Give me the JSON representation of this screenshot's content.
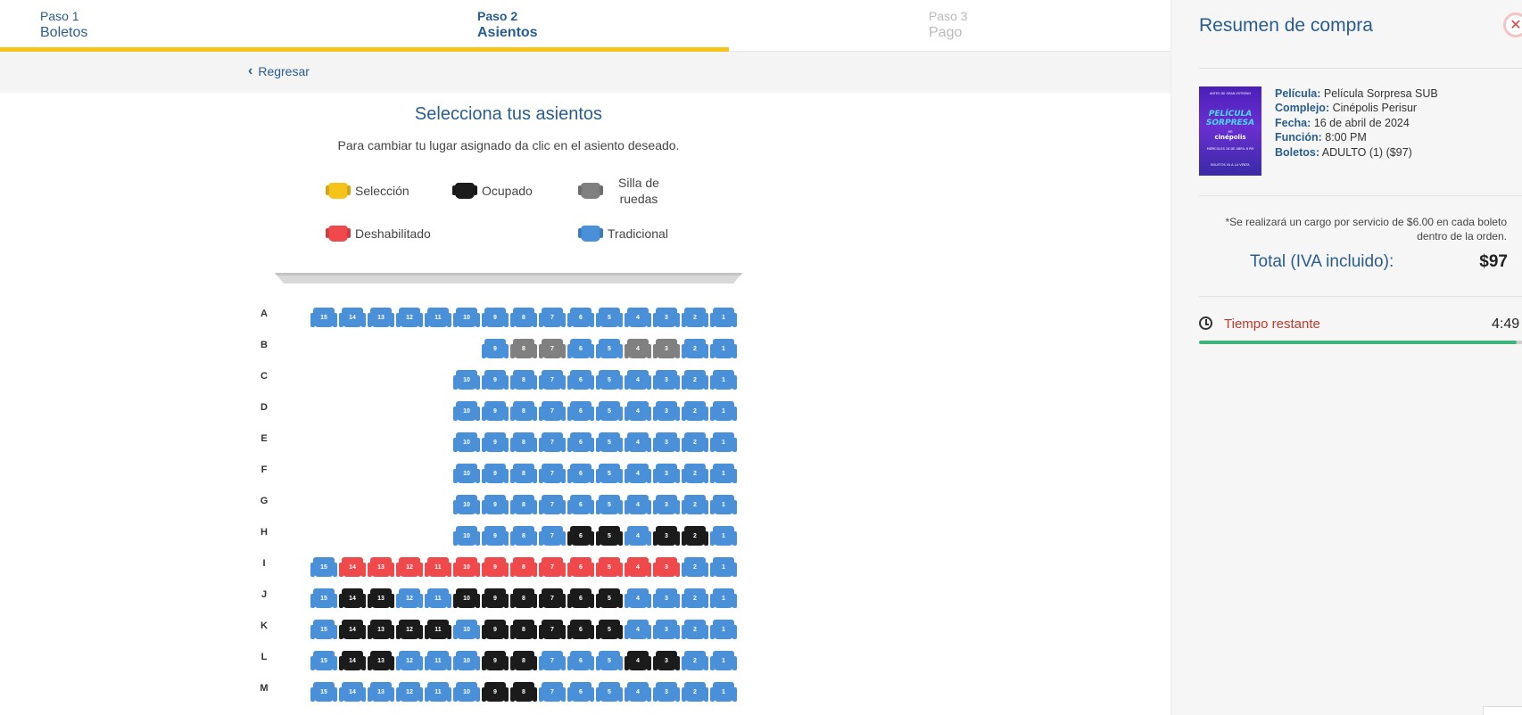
{
  "steps": [
    {
      "num": "Paso 1",
      "name": "Boletos",
      "state": "done"
    },
    {
      "num": "Paso 2",
      "name": "Asientos",
      "state": "active"
    },
    {
      "num": "Paso 3",
      "name": "Pago",
      "state": "pending"
    }
  ],
  "back_label": "Regresar",
  "seat_selection": {
    "title": "Selecciona tus asientos",
    "subtitle": "Para cambiar tu lugar asignado da clic en el asiento deseado."
  },
  "legend": {
    "seleccion": "Selección",
    "ocupado": "Ocupado",
    "silla_line1": "Silla de",
    "silla_line2": "ruedas",
    "deshabilitado": "Deshabilitado",
    "tradicional": "Tradicional"
  },
  "colors": {
    "seleccion": "#f6c31a",
    "ocupado": "#1b1b1b",
    "silla": "#808080",
    "deshabilitado": "#f0494b",
    "tradicional": "#4a90d9",
    "brand": "#2a5d8f"
  },
  "seat_rows": [
    {
      "label": "A",
      "seats": [
        "t15",
        "t14",
        "t13",
        "t12",
        "t11",
        "t10",
        "t9",
        "t8",
        "t7",
        "t6",
        "t5",
        "t4",
        "t3",
        "t2",
        "t1"
      ]
    },
    {
      "label": "B",
      "seats": [
        "t9",
        "w8",
        "w7",
        "t6",
        "t5",
        "w4",
        "w3",
        "t2",
        "t1"
      ]
    },
    {
      "label": "C",
      "seats": [
        "t10",
        "t9",
        "t8",
        "t7",
        "t6",
        "t5",
        "t4",
        "t3",
        "t2",
        "t1"
      ]
    },
    {
      "label": "D",
      "seats": [
        "t10",
        "t9",
        "t8",
        "t7",
        "t6",
        "t5",
        "t4",
        "t3",
        "t2",
        "t1"
      ]
    },
    {
      "label": "E",
      "seats": [
        "t10",
        "t9",
        "t8",
        "t7",
        "t6",
        "t5",
        "t4",
        "t3",
        "t2",
        "t1"
      ]
    },
    {
      "label": "F",
      "seats": [
        "t10",
        "t9",
        "t8",
        "t7",
        "t6",
        "t5",
        "t4",
        "t3",
        "t2",
        "t1"
      ]
    },
    {
      "label": "G",
      "seats": [
        "t10",
        "t9",
        "t8",
        "t7",
        "t6",
        "t5",
        "t4",
        "t3",
        "t2",
        "t1"
      ]
    },
    {
      "label": "H",
      "seats": [
        "t10",
        "t9",
        "t8",
        "t7",
        "o6",
        "o5",
        "t4",
        "o3",
        "o2",
        "t1"
      ]
    },
    {
      "label": "I",
      "seats": [
        "t15",
        "d14",
        "d13",
        "d12",
        "d11",
        "d10",
        "d9",
        "d8",
        "d7",
        "d6",
        "d5",
        "d4",
        "d3",
        "t2",
        "t1"
      ]
    },
    {
      "label": "J",
      "seats": [
        "t15",
        "o14",
        "o13",
        "t12",
        "t11",
        "o10",
        "o9",
        "o8",
        "o7",
        "o6",
        "o5",
        "t4",
        "t3",
        "t2",
        "t1"
      ]
    },
    {
      "label": "K",
      "seats": [
        "t15",
        "o14",
        "o13",
        "o12",
        "o11",
        "t10",
        "o9",
        "o8",
        "o7",
        "o6",
        "o5",
        "t4",
        "t3",
        "t2",
        "t1"
      ]
    },
    {
      "label": "L",
      "seats": [
        "t15",
        "o14",
        "o13",
        "t12",
        "t11",
        "t10",
        "o9",
        "o8",
        "t7",
        "t6",
        "t5",
        "o4",
        "o3",
        "t2",
        "t1"
      ]
    },
    {
      "label": "M",
      "seats": [
        "t15",
        "t14",
        "t13",
        "t12",
        "t11",
        "t10",
        "o9",
        "o8",
        "t7",
        "t6",
        "t5",
        "t4",
        "t3",
        "t2",
        "t1"
      ]
    }
  ],
  "summary": {
    "title": "Resumen de compra",
    "close_icon": "✕",
    "poster": {
      "line_top": "ANTES DE GRAN ESTRENO",
      "title_1": "PELÍCULA",
      "title_2": "SORPRESA",
      "sub": "en",
      "brand": "cinépolis",
      "date_line": "MIÉRCOLES 16 DE ABRIL 8 PM",
      "bottom": "BOLETOS YA A LA VENTA"
    },
    "fields": [
      {
        "label": "Película:",
        "value": "Película Sorpresa SUB"
      },
      {
        "label": "Complejo:",
        "value": "Cinépolis Perisur"
      },
      {
        "label": "Fecha:",
        "value": "16 de abril de 2024"
      },
      {
        "label": "Función:",
        "value": "8:00 PM"
      },
      {
        "label": "Boletos:",
        "value": "ADULTO (1) ($97)"
      }
    ],
    "service_note": "*Se realizará un cargo por servicio de $6.00 en cada boleto dentro de la orden.",
    "total_label": "Total (IVA incluido):",
    "total_value": "$97",
    "timer_label": "Tiempo restante",
    "timer_value": "4:49",
    "timer_progress": 0.98
  }
}
